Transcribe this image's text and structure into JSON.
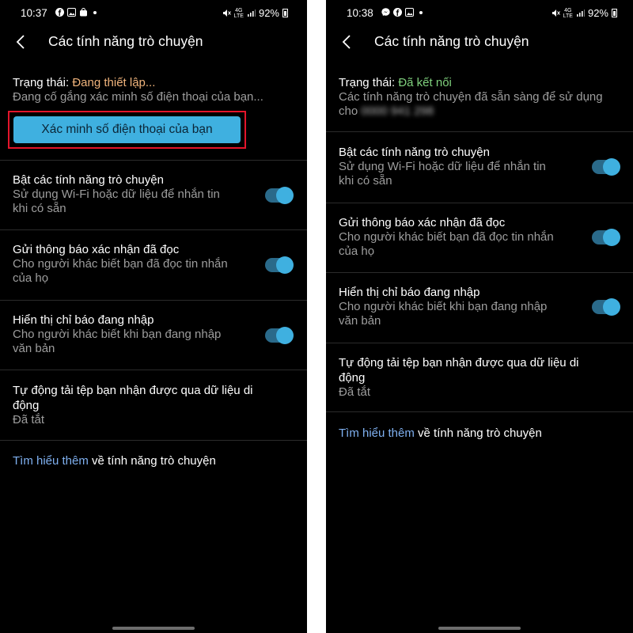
{
  "status_bar": {
    "left_time": "10:37",
    "right_time": "10:38",
    "net_top": "4G",
    "net_bottom": "LTE",
    "battery": "92%"
  },
  "header": {
    "title": "Các tính năng trò chuyện"
  },
  "left": {
    "status_label": "Trạng thái:",
    "status_value": "Đang thiết lập...",
    "status_desc": "Đang cố gắng xác minh số điện thoại của bạn...",
    "verify_button": "Xác minh số điện thoại của bạn"
  },
  "right": {
    "status_label": "Trạng thái:",
    "status_value": "Đã kết nối",
    "status_desc_line1": "Các tính năng trò chuyện đã sẵn sàng để sử dụng",
    "status_desc_line2": "cho",
    "blurred_number": "0000 941 298"
  },
  "settings": {
    "chat_title": "Bật các tính năng trò chuyện",
    "chat_desc_1": "Sử dụng Wi-Fi hoặc dữ liệu để nhắn tin",
    "chat_desc_2": "khi có sẵn",
    "read_title": "Gửi thông báo xác nhận đã đọc",
    "read_desc_1": "Cho người khác biết bạn đã đọc tin nhắn",
    "read_desc_2": "của họ",
    "typing_title": "Hiển thị chỉ báo đang nhập",
    "typing_desc_1": "Cho người khác biết khi bạn đang nhập",
    "typing_desc_2": "văn bản",
    "download_title_1": "Tự động tải tệp bạn nhận được qua dữ liệu di",
    "download_title_2": "động",
    "download_value": "Đã tắt"
  },
  "learn_more": {
    "link": "Tìm hiểu thêm",
    "rest": " về tính năng trò chuyện"
  },
  "toggles": {
    "chat": true,
    "read_receipts": true,
    "typing": true
  },
  "colors": {
    "accent": "#3fb0e0",
    "pending": "#f0b47c",
    "connected": "#7fd07d",
    "link": "#7fb0f0",
    "highlight_box": "#e3152b"
  }
}
